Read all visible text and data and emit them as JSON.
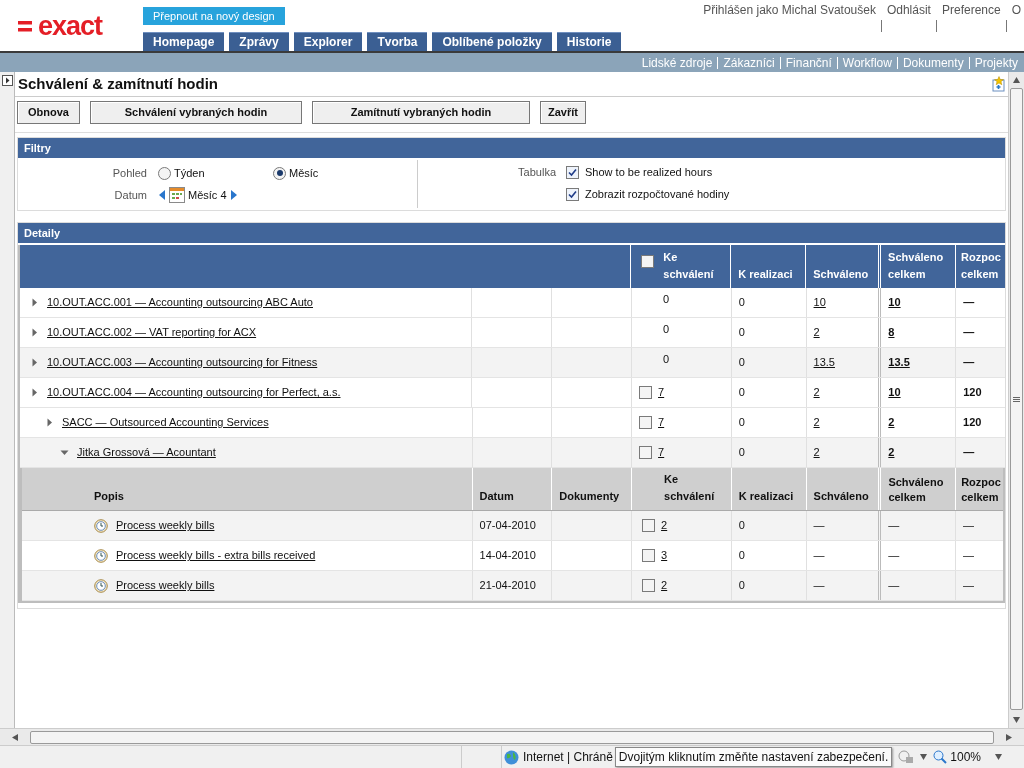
{
  "header": {
    "logo": "exact",
    "switch_button": "Přepnout na nový design",
    "nav_tabs": [
      "Homepage",
      "Zprávy",
      "Explorer",
      "Tvorba",
      "Oblíbené položky",
      "Historie"
    ],
    "user_links": [
      "Přihlášen jako Michal Svatoušek",
      "Odhlásit",
      "Preference",
      "O"
    ]
  },
  "module_links": [
    "Lidské zdroje",
    "Zákazníci",
    "Finanční",
    "Workflow",
    "Dokumenty",
    "Projekty"
  ],
  "page": {
    "title": "Schválení & zamítnutí hodin",
    "toolbar": [
      "Obnova",
      "Schválení vybraných hodin",
      "Zamítnutí vybraných hodin",
      "Zavřít"
    ]
  },
  "filters": {
    "title": "Filtry",
    "view_label": "Pohled",
    "view_options": [
      {
        "label": "Týden",
        "selected": false
      },
      {
        "label": "Měsíc",
        "selected": true
      }
    ],
    "date_label": "Datum",
    "date_value": "Měsíc 4",
    "table_label": "Tabulka",
    "table_options": [
      {
        "label": "Show to be realized hours",
        "checked": true
      },
      {
        "label": "Zobrazit rozpočtované hodiny",
        "checked": true
      }
    ]
  },
  "details": {
    "title": "Detaily",
    "columns": [
      "Ke schválení",
      "K realizaci",
      "Schváleno",
      "Schváleno celkem",
      "Rozpoc celkem"
    ],
    "header_checked": false,
    "rows": [
      {
        "name": "10.OUT.ACC.001 — Accounting outsourcing ABC Auto",
        "expanded": false,
        "approvable": false,
        "to_approve": "0",
        "to_realize": "0",
        "approved": "10",
        "approved_total": "10",
        "budget_total": "—"
      },
      {
        "name": "10.OUT.ACC.002 — VAT reporting for ACX",
        "expanded": false,
        "approvable": false,
        "to_approve": "0",
        "to_realize": "0",
        "approved": "2",
        "approved_total": "8",
        "budget_total": "—"
      },
      {
        "name": "10.OUT.ACC.003 — Accounting outsourcing for Fitness",
        "expanded": false,
        "approvable": false,
        "to_approve": "0",
        "to_realize": "0",
        "approved": "13.5",
        "approved_total": "13.5",
        "budget_total": "—"
      },
      {
        "name": "10.OUT.ACC.004 — Accounting outsourcing for Perfect, a.s.",
        "expanded": false,
        "approvable": true,
        "checked": false,
        "to_approve": "7",
        "to_realize": "0",
        "approved": "2",
        "approved_total": "10",
        "budget_total": "120",
        "children": [
          {
            "name": "SACC — Outsourced Accounting Services",
            "expanded": false,
            "approvable": true,
            "checked": false,
            "to_approve": "7",
            "to_realize": "0",
            "approved": "2",
            "approved_total": "2",
            "budget_total": "120",
            "children": [
              {
                "name": "Jitka Grossová — Acountant",
                "expanded": true,
                "approvable": true,
                "checked": false,
                "to_approve": "7",
                "to_realize": "0",
                "approved": "2",
                "approved_total": "2",
                "budget_total": "—",
                "entries": {
                  "columns": [
                    "Popis",
                    "Datum",
                    "Dokumenty",
                    "Ke schválení",
                    "K realizaci",
                    "Schváleno",
                    "Schváleno celkem",
                    "Rozpoc celkem"
                  ],
                  "rows": [
                    {
                      "description": "Process weekly bills",
                      "date": "07-04-2010",
                      "checked": false,
                      "to_approve": "2",
                      "to_realize": "0",
                      "approved": "—",
                      "approved_total": "—",
                      "budget_total": "—"
                    },
                    {
                      "description": "Process weekly bills - extra bills received",
                      "date": "14-04-2010",
                      "checked": false,
                      "to_approve": "3",
                      "to_realize": "0",
                      "approved": "—",
                      "approved_total": "—",
                      "budget_total": "—"
                    },
                    {
                      "description": "Process weekly bills",
                      "date": "21-04-2010",
                      "checked": false,
                      "to_approve": "2",
                      "to_realize": "0",
                      "approved": "—",
                      "approved_total": "—",
                      "budget_total": "—"
                    }
                  ]
                }
              }
            ]
          }
        ]
      }
    ]
  },
  "status_bar": {
    "zone": "Internet | Chráně",
    "tooltip": "Dvojitým kliknutím změňte nastavení zabezpečení.",
    "zoom": "100%"
  }
}
